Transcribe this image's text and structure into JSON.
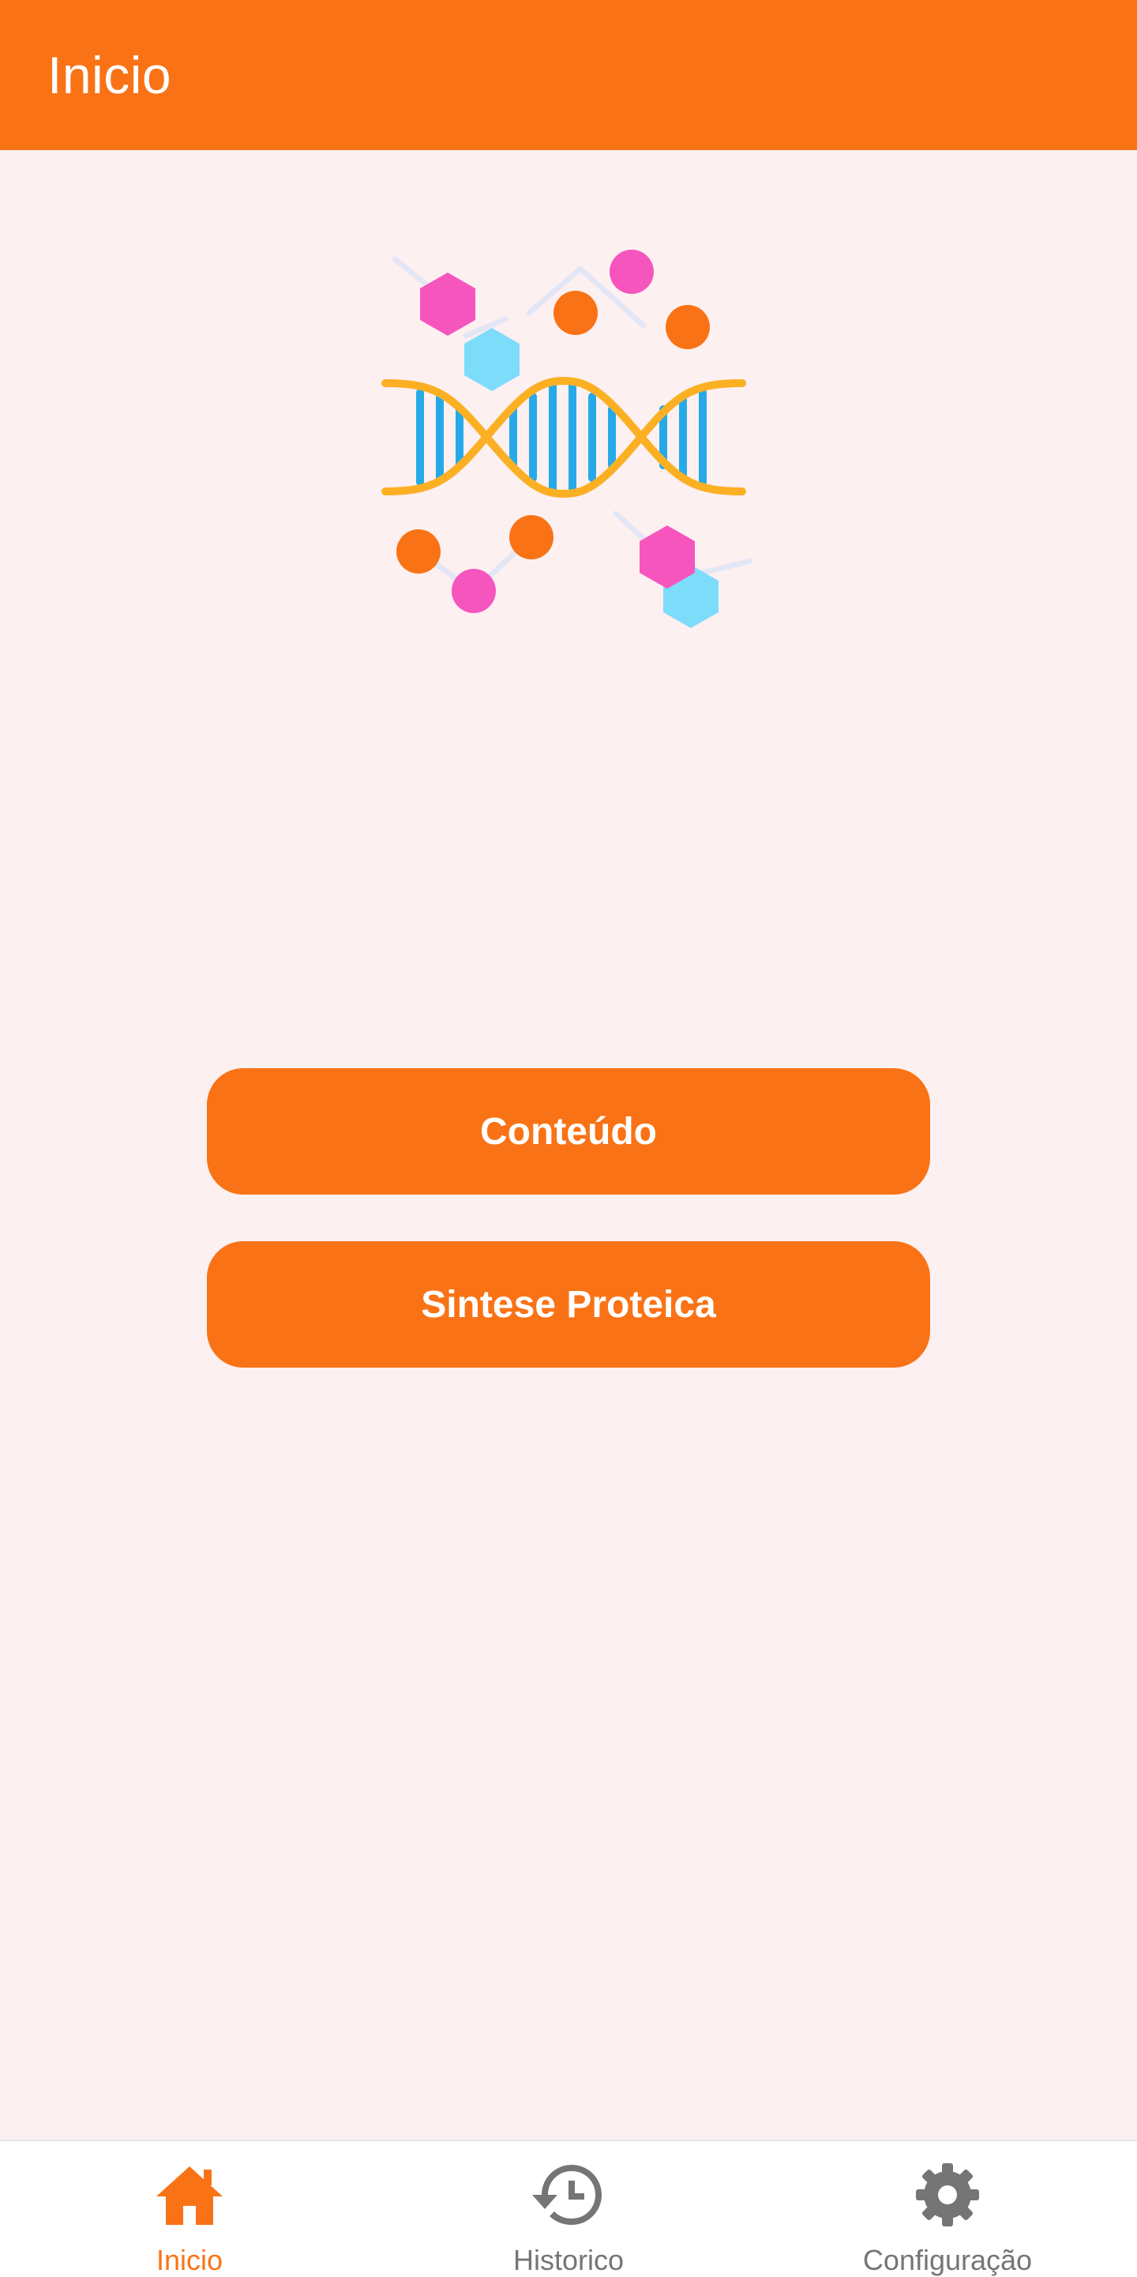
{
  "appbar": {
    "title": "Inicio"
  },
  "illustration": {
    "icon": "dna-molecule-illustration"
  },
  "buttons": {
    "conteudo": "Conteúdo",
    "sintese": "Sintese Proteica"
  },
  "bottom_nav": {
    "items": [
      {
        "label": "Inicio",
        "icon": "home-icon",
        "active": true
      },
      {
        "label": "Historico",
        "icon": "history-icon",
        "active": false
      },
      {
        "label": "Configuração",
        "icon": "gear-icon",
        "active": false
      }
    ]
  },
  "colors": {
    "primary": "#F97316",
    "background": "#FDF0F1",
    "nav_inactive": "#757575"
  }
}
